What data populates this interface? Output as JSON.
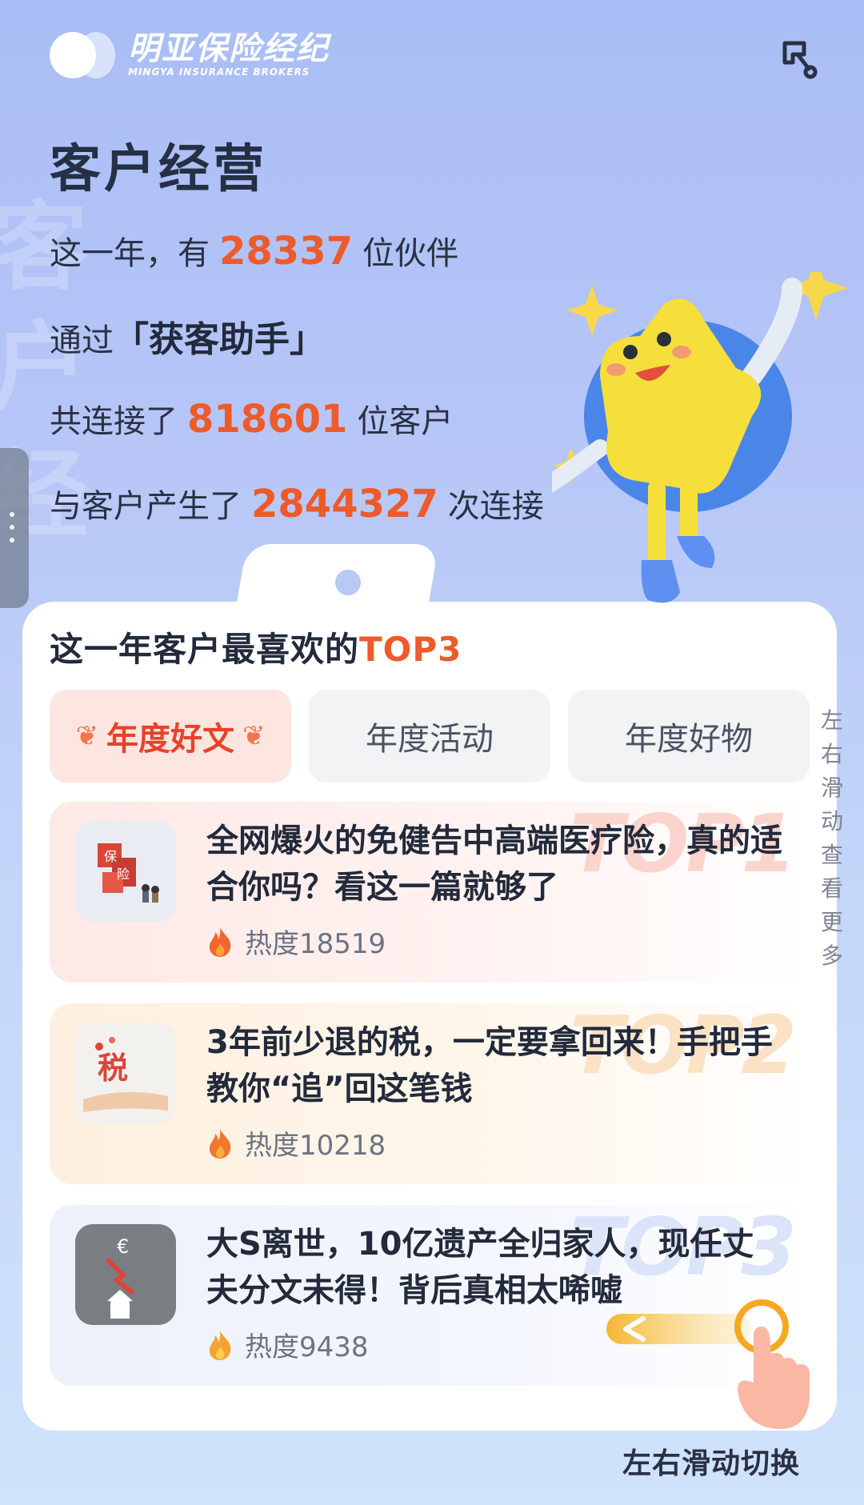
{
  "brand": {
    "name_cn": "明亚保险经纪",
    "name_en": "MINGYA INSURANCE BROKERS"
  },
  "page": {
    "title": "客户经营",
    "background_chars": [
      "客",
      "户",
      "经"
    ]
  },
  "stats": {
    "line1": {
      "prefix": "这一年，有",
      "value": "28337",
      "suffix": "位伙伴"
    },
    "line2": {
      "prefix": "通过",
      "strong": "「获客助手」"
    },
    "line3": {
      "prefix": "共连接了",
      "value": "818601",
      "suffix": "位客户"
    },
    "line4": {
      "prefix": "与客户产生了",
      "value": "2844327",
      "suffix": "次连接"
    }
  },
  "top3": {
    "title_prefix": "这一年客户最喜欢的",
    "title_highlight": "TOP3",
    "tabs": [
      {
        "label": "年度好文",
        "active": true
      },
      {
        "label": "年度活动",
        "active": false
      },
      {
        "label": "年度好物",
        "active": false
      }
    ],
    "side_hint": "左右滑动查看更多",
    "items": [
      {
        "rank": "TOP1",
        "title": "全网爆火的免健告中高端医疗险，真的适合你吗？看这一篇就够了",
        "heat": "热度18519",
        "thumb_icon": "insurance-blocks-icon"
      },
      {
        "rank": "TOP2",
        "title": "3年前少退的税，一定要拿回来！手把手教你“追”回这笔钱",
        "heat": "热度10218",
        "thumb_icon": "tax-hand-icon"
      },
      {
        "rank": "TOP3",
        "title": "大S离世，10亿遗产全归家人，现任丈夫分文未得！背后真相太唏嘘",
        "heat": "热度9438",
        "thumb_icon": "euro-house-icon"
      }
    ]
  },
  "bottom_hint": "左右滑动切换",
  "colors": {
    "accent": "#ee5a2a",
    "active_tab_bg": "#fde5e0",
    "heat_flame": "#f2662e"
  }
}
